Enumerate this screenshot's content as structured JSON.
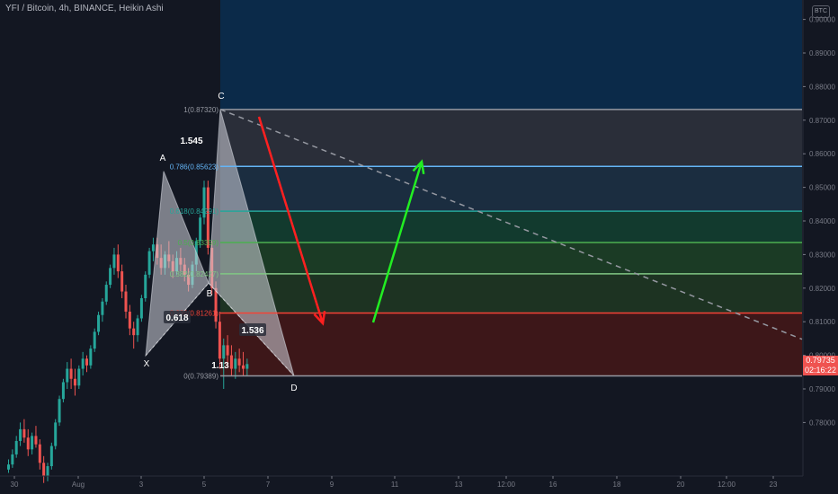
{
  "header": {
    "title": "YFI / Bitcoin, 4h, BINANCE, Heikin Ashi",
    "currency_badge": "BTC"
  },
  "price_tag": {
    "price": "0.79735",
    "countdown": "02:16:22"
  },
  "colors": {
    "up": "#26a69a",
    "down": "#ef5350",
    "bg": "#131722",
    "axis_text": "#787b86",
    "arrow_down": "#ff2020",
    "arrow_up": "#22ee22",
    "pattern_fill": "#d1d4dc"
  },
  "chart_data": {
    "type": "candlestick",
    "y_axis": {
      "ylim": [
        0.7635,
        0.9065
      ],
      "ticks": [
        "0.78000",
        "0.79000",
        "0.80000",
        "0.81000",
        "0.82000",
        "0.83000",
        "0.84000",
        "0.85000",
        "0.86000",
        "0.87000",
        "0.88000",
        "0.89000",
        "0.90000"
      ]
    },
    "x_axis": {
      "ticks": [
        "30",
        "Aug",
        "3",
        "5",
        "7",
        "9",
        "11",
        "13",
        "12:00",
        "16",
        "18",
        "20",
        "12:00",
        "23"
      ]
    },
    "candles": [
      {
        "o": 0.766,
        "h": 0.769,
        "l": 0.765,
        "c": 0.7675
      },
      {
        "o": 0.7675,
        "h": 0.772,
        "l": 0.7665,
        "c": 0.7705
      },
      {
        "o": 0.7705,
        "h": 0.776,
        "l": 0.7695,
        "c": 0.7745
      },
      {
        "o": 0.7745,
        "h": 0.78,
        "l": 0.773,
        "c": 0.778
      },
      {
        "o": 0.778,
        "h": 0.781,
        "l": 0.774,
        "c": 0.7755
      },
      {
        "o": 0.7755,
        "h": 0.778,
        "l": 0.77,
        "c": 0.772
      },
      {
        "o": 0.772,
        "h": 0.777,
        "l": 0.7705,
        "c": 0.776
      },
      {
        "o": 0.776,
        "h": 0.779,
        "l": 0.7725,
        "c": 0.7735
      },
      {
        "o": 0.7735,
        "h": 0.775,
        "l": 0.766,
        "c": 0.768
      },
      {
        "o": 0.768,
        "h": 0.77,
        "l": 0.762,
        "c": 0.764
      },
      {
        "o": 0.764,
        "h": 0.768,
        "l": 0.7625,
        "c": 0.767
      },
      {
        "o": 0.767,
        "h": 0.774,
        "l": 0.766,
        "c": 0.773
      },
      {
        "o": 0.773,
        "h": 0.781,
        "l": 0.772,
        "c": 0.78
      },
      {
        "o": 0.78,
        "h": 0.788,
        "l": 0.779,
        "c": 0.787
      },
      {
        "o": 0.787,
        "h": 0.793,
        "l": 0.786,
        "c": 0.792
      },
      {
        "o": 0.792,
        "h": 0.798,
        "l": 0.79,
        "c": 0.796
      },
      {
        "o": 0.796,
        "h": 0.799,
        "l": 0.79,
        "c": 0.793
      },
      {
        "o": 0.793,
        "h": 0.796,
        "l": 0.788,
        "c": 0.791
      },
      {
        "o": 0.791,
        "h": 0.797,
        "l": 0.79,
        "c": 0.796
      },
      {
        "o": 0.796,
        "h": 0.801,
        "l": 0.794,
        "c": 0.799
      },
      {
        "o": 0.799,
        "h": 0.8,
        "l": 0.795,
        "c": 0.797
      },
      {
        "o": 0.797,
        "h": 0.803,
        "l": 0.796,
        "c": 0.802
      },
      {
        "o": 0.802,
        "h": 0.808,
        "l": 0.801,
        "c": 0.807
      },
      {
        "o": 0.807,
        "h": 0.813,
        "l": 0.806,
        "c": 0.812
      },
      {
        "o": 0.812,
        "h": 0.817,
        "l": 0.81,
        "c": 0.816
      },
      {
        "o": 0.816,
        "h": 0.822,
        "l": 0.815,
        "c": 0.821
      },
      {
        "o": 0.821,
        "h": 0.827,
        "l": 0.82,
        "c": 0.826
      },
      {
        "o": 0.826,
        "h": 0.832,
        "l": 0.824,
        "c": 0.83
      },
      {
        "o": 0.83,
        "h": 0.833,
        "l": 0.823,
        "c": 0.825
      },
      {
        "o": 0.825,
        "h": 0.827,
        "l": 0.817,
        "c": 0.819
      },
      {
        "o": 0.819,
        "h": 0.821,
        "l": 0.811,
        "c": 0.813
      },
      {
        "o": 0.813,
        "h": 0.815,
        "l": 0.806,
        "c": 0.808
      },
      {
        "o": 0.808,
        "h": 0.81,
        "l": 0.802,
        "c": 0.806
      },
      {
        "o": 0.806,
        "h": 0.812,
        "l": 0.804,
        "c": 0.811
      },
      {
        "o": 0.811,
        "h": 0.818,
        "l": 0.81,
        "c": 0.817
      },
      {
        "o": 0.817,
        "h": 0.825,
        "l": 0.816,
        "c": 0.824
      },
      {
        "o": 0.824,
        "h": 0.832,
        "l": 0.823,
        "c": 0.831
      },
      {
        "o": 0.831,
        "h": 0.835,
        "l": 0.828,
        "c": 0.833
      },
      {
        "o": 0.833,
        "h": 0.835,
        "l": 0.827,
        "c": 0.829
      },
      {
        "o": 0.829,
        "h": 0.833,
        "l": 0.824,
        "c": 0.826
      },
      {
        "o": 0.826,
        "h": 0.831,
        "l": 0.824,
        "c": 0.83
      },
      {
        "o": 0.83,
        "h": 0.834,
        "l": 0.826,
        "c": 0.828
      },
      {
        "o": 0.828,
        "h": 0.83,
        "l": 0.823,
        "c": 0.825
      },
      {
        "o": 0.825,
        "h": 0.831,
        "l": 0.824,
        "c": 0.829
      },
      {
        "o": 0.829,
        "h": 0.832,
        "l": 0.825,
        "c": 0.827
      },
      {
        "o": 0.827,
        "h": 0.829,
        "l": 0.822,
        "c": 0.824
      },
      {
        "o": 0.824,
        "h": 0.826,
        "l": 0.819,
        "c": 0.821
      },
      {
        "o": 0.821,
        "h": 0.828,
        "l": 0.82,
        "c": 0.827
      },
      {
        "o": 0.827,
        "h": 0.835,
        "l": 0.825,
        "c": 0.834
      },
      {
        "o": 0.834,
        "h": 0.842,
        "l": 0.832,
        "c": 0.841
      },
      {
        "o": 0.841,
        "h": 0.852,
        "l": 0.839,
        "c": 0.85
      },
      {
        "o": 0.85,
        "h": 0.852,
        "l": 0.83,
        "c": 0.832
      },
      {
        "o": 0.832,
        "h": 0.834,
        "l": 0.818,
        "c": 0.82
      },
      {
        "o": 0.82,
        "h": 0.822,
        "l": 0.808,
        "c": 0.81
      },
      {
        "o": 0.81,
        "h": 0.813,
        "l": 0.796,
        "c": 0.799
      },
      {
        "o": 0.799,
        "h": 0.805,
        "l": 0.79,
        "c": 0.803
      },
      {
        "o": 0.803,
        "h": 0.806,
        "l": 0.797,
        "c": 0.8
      },
      {
        "o": 0.8,
        "h": 0.803,
        "l": 0.794,
        "c": 0.796
      },
      {
        "o": 0.796,
        "h": 0.801,
        "l": 0.793,
        "c": 0.799
      },
      {
        "o": 0.799,
        "h": 0.802,
        "l": 0.795,
        "c": 0.797
      },
      {
        "o": 0.797,
        "h": 0.801,
        "l": 0.794,
        "c": 0.796
      },
      {
        "o": 0.796,
        "h": 0.799,
        "l": 0.794,
        "c": 0.7974
      }
    ],
    "fib_levels": [
      {
        "label": "1(0.87320)",
        "price": 0.8732,
        "color": "#9598a1"
      },
      {
        "label": "0.786(0.85623)",
        "price": 0.85623,
        "color": "#64b5f6"
      },
      {
        "label": "0.618(0.84291)",
        "price": 0.84291,
        "color": "#26a69a"
      },
      {
        "label": "0.5(0.83359)",
        "price": 0.83359,
        "color": "#4caf50"
      },
      {
        "label": "0.382(0.82427)",
        "price": 0.82427,
        "color": "#81c784"
      },
      {
        "label": "0.236(0.81261)",
        "price": 0.81261,
        "color": "#f44336"
      },
      {
        "label": "0(0.79389)",
        "price": 0.79389,
        "color": "#9598a1"
      }
    ],
    "fib_zones": [
      {
        "from": 0.8732,
        "to": 0.906,
        "color": "#0b2a49"
      },
      {
        "from": 0.85623,
        "to": 0.8732,
        "color": "#2a2e39"
      },
      {
        "from": 0.84291,
        "to": 0.85623,
        "color": "#1b2d40"
      },
      {
        "from": 0.83359,
        "to": 0.84291,
        "color": "#123a2e"
      },
      {
        "from": 0.82427,
        "to": 0.83359,
        "color": "#1b3b25"
      },
      {
        "from": 0.81261,
        "to": 0.82427,
        "color": "#1d3322"
      },
      {
        "from": 0.79389,
        "to": 0.81261,
        "color": "#3d1719"
      }
    ],
    "pattern_points": [
      {
        "label": "X",
        "price": 0.7999
      },
      {
        "label": "A",
        "price": 0.8548
      },
      {
        "label": "B",
        "price": 0.8215
      },
      {
        "label": "C",
        "price": 0.8732
      },
      {
        "label": "D",
        "price": 0.7939
      }
    ],
    "ratio_labels": [
      "1.545",
      "0.618",
      "1.536",
      "1.13"
    ]
  }
}
